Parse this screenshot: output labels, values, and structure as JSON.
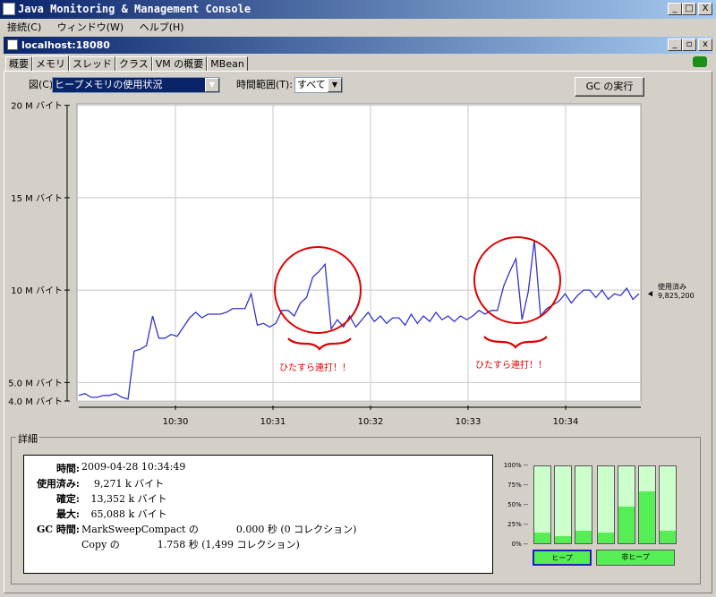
{
  "window": {
    "title": "Java Monitoring & Management Console",
    "minimize": "_",
    "maximize": "□",
    "close": "X"
  },
  "menu": [
    "接続(C)",
    "ウィンドウ(W)",
    "ヘルプ(H)"
  ],
  "inner": {
    "title": "localhost:18080"
  },
  "tabs": [
    "概要",
    "メモリ",
    "スレッド",
    "クラス",
    "VM の概要",
    "MBean"
  ],
  "controls": {
    "chart_label": "図(C):",
    "chart_value": "ヒープメモリの使用状況",
    "range_label": "時間範囲(T):",
    "range_value": "すべて",
    "gc_button": "GC の実行"
  },
  "chart_data": {
    "type": "line",
    "y_ticks": [
      "20 M バイト",
      "15 M バイト",
      "10 M バイト",
      "5.0 M バイト",
      "4.0 M バイト"
    ],
    "x_ticks": [
      "10:30",
      "10:31",
      "10:32",
      "10:33",
      "10:34"
    ],
    "ylim": [
      4,
      20
    ],
    "current_label": "使用済み",
    "current_value": "9,825,200",
    "annotations": [
      "ひたすら連打！！",
      "ひたすら連打！！"
    ],
    "values": [
      4.3,
      4.4,
      4.2,
      4.2,
      4.3,
      4.3,
      4.4,
      4.2,
      4.1,
      6.7,
      6.8,
      7.0,
      8.6,
      7.4,
      7.4,
      7.6,
      7.5,
      8.0,
      8.5,
      8.8,
      8.5,
      8.7,
      8.7,
      8.7,
      8.8,
      9.0,
      9.0,
      9.0,
      9.8,
      8.1,
      8.2,
      8.0,
      8.2,
      8.9,
      8.9,
      8.6,
      9.3,
      9.6,
      10.7,
      11.0,
      11.4,
      7.9,
      8.4,
      8.0,
      8.6,
      8.0,
      8.4,
      8.8,
      8.3,
      8.6,
      8.2,
      8.5,
      8.5,
      8.1,
      8.7,
      8.2,
      8.6,
      8.3,
      8.8,
      8.4,
      8.6,
      8.3,
      8.6,
      8.4,
      8.6,
      8.9,
      8.7,
      8.9,
      8.9,
      10.2,
      11.0,
      11.7,
      8.4,
      9.9,
      12.7,
      8.6,
      9.0,
      9.2,
      9.4,
      9.8,
      9.3,
      9.7,
      10.0,
      10.0,
      9.6,
      10.0,
      9.5,
      9.8,
      9.7,
      10.1,
      9.5,
      9.8
    ]
  },
  "details": {
    "section": "詳細",
    "rows": [
      {
        "k": "時間:",
        "v": "2009-04-28 10:34:49"
      },
      {
        "k": "使用済み:",
        "v": "    9,271 k バイト"
      },
      {
        "k": "確定:",
        "v": "   13,352 k バイト"
      },
      {
        "k": "最大:",
        "v": "   65,088 k バイト"
      },
      {
        "k": "GC 時間:",
        "v": "MarkSweepCompact の            0.000 秒 (0 コレクション)"
      },
      {
        "k": "",
        "v": "Copy の            1.758 秒 (1,499 コレクション)"
      }
    ]
  },
  "bars": {
    "ticks": [
      "100%",
      "75%",
      "50%",
      "25%",
      "0%"
    ],
    "heap": [
      0.14,
      0.09,
      0.16
    ],
    "nonheap": [
      0.14,
      0.48,
      0.68,
      0.16
    ],
    "heap_label": "ヒープ",
    "nonheap_label": "非ヒープ"
  }
}
